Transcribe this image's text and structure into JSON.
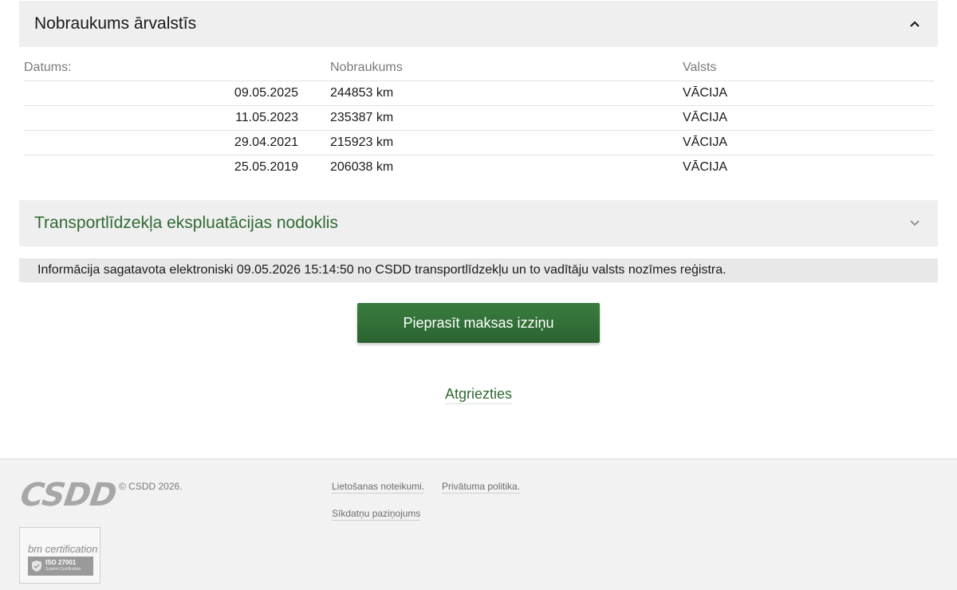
{
  "mileage_panel": {
    "title": "Nobraukums ārvalstīs",
    "columns": [
      "Datums:",
      "Nobraukums",
      "Valsts"
    ],
    "rows": [
      {
        "date": "09.05.2025",
        "km": "244853 km",
        "country": "VĀCIJA"
      },
      {
        "date": "11.05.2023",
        "km": "235387 km",
        "country": "VĀCIJA"
      },
      {
        "date": "29.04.2021",
        "km": "215923 km",
        "country": "VĀCIJA"
      },
      {
        "date": "25.05.2019",
        "km": "206038 km",
        "country": "VĀCIJA"
      }
    ],
    "icon": "chevron-up-icon"
  },
  "tax_panel": {
    "title": "Transportlīdzekļa ekspluatācijas nodoklis",
    "icon": "chevron-down-icon",
    "title_color": "#2f6a34"
  },
  "info_text": "Informācija sagatavota elektroniski 09.05.2026 15:14:50 no CSDD transportlīdzekļu un to vadītāju valsts nozīmes reģistra.",
  "request_button_label": "Pieprasīt maksas izziņu",
  "back_link_label": "Atgriezties",
  "footer": {
    "logo_text": "CSDD",
    "copyright": "© CSDD 2026.",
    "links": [
      "Lietošanas noteikumi.",
      "Privātuma politika.",
      "Sīkdatņu paziņojums"
    ],
    "cert": {
      "name": "bm certification",
      "standard": "ISO 27001",
      "sub": "System Certification"
    }
  },
  "colors": {
    "brand_green": "#2f6a34",
    "button_green": "#2a6330",
    "panel_bg": "#efefef"
  }
}
